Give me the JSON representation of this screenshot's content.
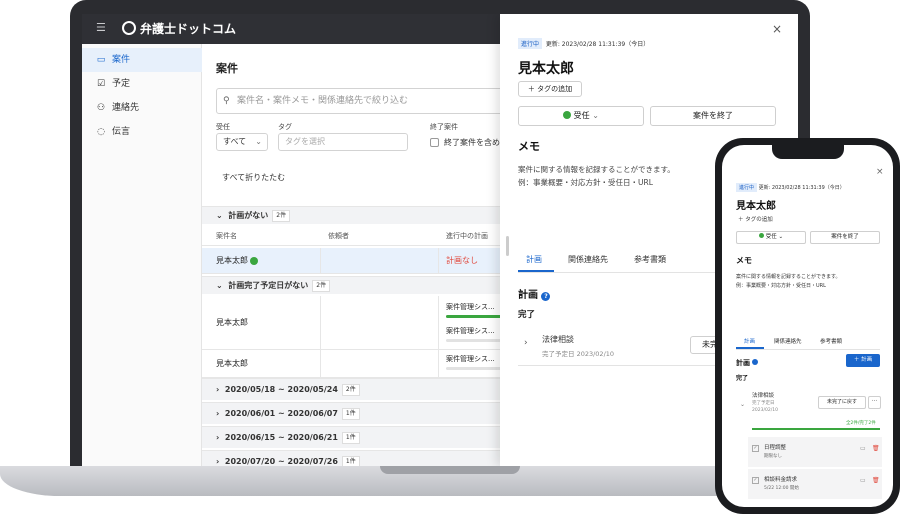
{
  "app": {
    "logo": "弁護士ドットコム"
  },
  "sidebar": {
    "items": [
      {
        "label": "案件",
        "icon": "folder-icon"
      },
      {
        "label": "予定",
        "icon": "checkbox-icon"
      },
      {
        "label": "連絡先",
        "icon": "person-icon"
      },
      {
        "label": "伝言",
        "icon": "message-icon"
      }
    ]
  },
  "main": {
    "title": "案件",
    "search_placeholder": "案件名・案件メモ・関係連絡先で絞り込む",
    "filters": {
      "assignee_label": "受任",
      "assignee_value": "すべて",
      "tag_label": "タグ",
      "tag_placeholder": "タグを選択",
      "closed_label": "終了案件",
      "closed_checkbox": "終了案件を含め"
    },
    "collapse_all": "すべて折りたたむ",
    "groups": [
      {
        "label": "計画がない",
        "count": "2件"
      },
      {
        "label": "計画完了予定日がない",
        "count": "2件"
      },
      {
        "label": "2020/05/18 ~ 2020/05/24",
        "count": "2件"
      },
      {
        "label": "2020/06/01 ~ 2020/06/07",
        "count": "1件"
      },
      {
        "label": "2020/06/15 ~ 2020/06/21",
        "count": "1件"
      },
      {
        "label": "2020/07/20 ~ 2020/07/26",
        "count": "1件"
      }
    ],
    "columns": [
      "案件名",
      "依頼者",
      "進行中の計画"
    ],
    "rows": [
      {
        "name": "見本太郎",
        "plan": "計画なし"
      },
      {
        "name": "見本太郎",
        "plan1": "案件管理シス...",
        "plan2": "案件管理シス..."
      },
      {
        "name": "見本太郎",
        "plan1": "案件管理シス..."
      }
    ]
  },
  "drawer": {
    "status_badge": "進行中",
    "updated": "更新: 2023/02/28 11:31:39（今日）",
    "name": "見本太郎",
    "add_tag": "タグの追加",
    "status_button": "受任",
    "end_button": "案件を終了",
    "memo_title": "メモ",
    "memo_line1": "案件に関する情報を記録することができます。",
    "memo_line2": "例：事業概要・対応方針・受任日・URL",
    "tabs": [
      "計画",
      "関係連絡先",
      "参考書類"
    ],
    "plan_title": "計画",
    "done_label": "完了",
    "item_title": "法律相談",
    "item_date": "完了予定日 2023/02/10",
    "item_button": "未完"
  },
  "phone": {
    "status_badge": "進行中",
    "updated": "更新: 2023/02/28 11:31:39（今日）",
    "name": "見本太郎",
    "add_tag": "タグの追加",
    "status_button": "受任",
    "end_button": "案件を終了",
    "memo_title": "メモ",
    "memo_line1": "案件に関する情報を記録することができます。",
    "memo_line2": "例：事業概要・対応方針・受任日・URL",
    "tabs": [
      "計画",
      "関係連絡先",
      "参考書類"
    ],
    "plan_title": "計画",
    "add_plan": "計画",
    "done_label": "完了",
    "item_title": "法律相談",
    "item_sub1": "完了予定日",
    "item_sub2": "2023/02/10",
    "revert_button": "未完了に戻す",
    "progress_text": "全2件/完了2件",
    "progress": 1.0,
    "tasks": [
      {
        "title": "日程調整",
        "sub": "期限なし"
      },
      {
        "title": "相談料金請求",
        "sub": "5/22 12:00 開始"
      }
    ]
  },
  "colors": {
    "accent": "#1a66cc",
    "success": "#3aa63f",
    "danger": "#e0463a"
  }
}
